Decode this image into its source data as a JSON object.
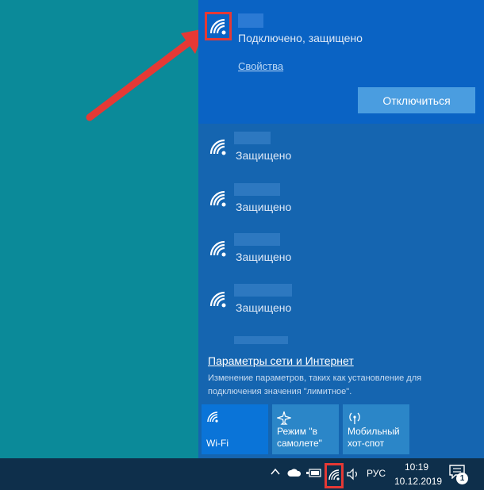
{
  "connected_network": {
    "status": "Подключено, защищено",
    "properties_label": "Свойства",
    "disconnect_label": "Отключиться"
  },
  "networks": [
    {
      "status": "Защищено"
    },
    {
      "status": "Защищено"
    },
    {
      "status": "Защищено"
    },
    {
      "status": "Защищено"
    }
  ],
  "settings": {
    "link_label": "Параметры сети и Интернет",
    "description": "Изменение параметров, таких как установление для подключения значения \"лимитное\"."
  },
  "quick_actions": [
    {
      "label": "Wi-Fi",
      "icon": "wifi-icon",
      "active": true
    },
    {
      "label": "Режим \"в самолете\"",
      "icon": "airplane-icon",
      "active": false
    },
    {
      "label": "Мобильный хот-спот",
      "icon": "hotspot-icon",
      "active": false
    }
  ],
  "taskbar": {
    "language": "РУС",
    "time": "10:19",
    "date": "10.12.2019",
    "notification_count": "1"
  },
  "colors": {
    "desktop": "#0b8a99",
    "flyout": "#1565b0",
    "accent": "#0a74d8",
    "highlight": "#e53935"
  }
}
